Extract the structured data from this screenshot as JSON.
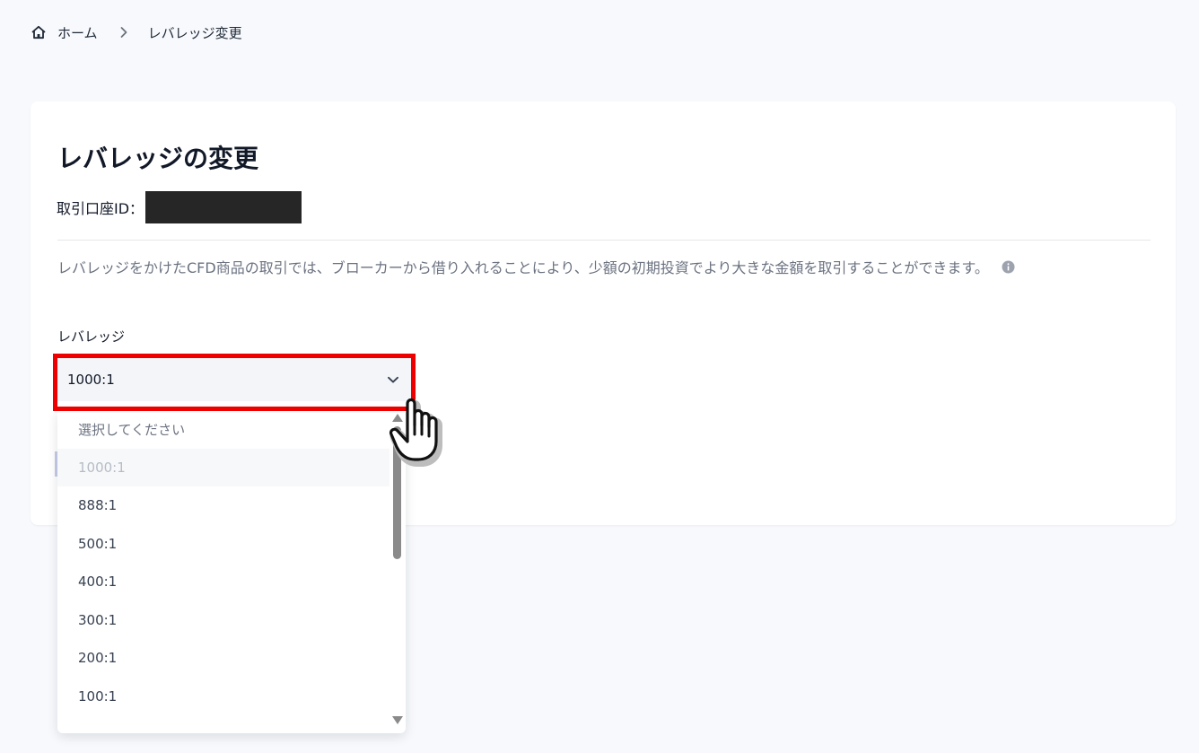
{
  "breadcrumb": {
    "home_label": "ホーム",
    "current_label": "レバレッジ変更"
  },
  "card": {
    "title": "レバレッジの変更",
    "account_label": "取引口座ID："
  },
  "description": {
    "text": "レバレッジをかけたCFD商品の取引では、ブローカーから借り入れることにより、少額の初期投資でより大きな金額を取引することができます。"
  },
  "leverage": {
    "label": "レバレッジ",
    "selected_value": "1000:1",
    "options": [
      "選択してください",
      "1000:1",
      "888:1",
      "500:1",
      "400:1",
      "300:1",
      "200:1",
      "100:1"
    ]
  },
  "icons": {
    "home": "home-icon",
    "separator": "chevron-right-icon",
    "info": "info-icon",
    "dropdown": "chevron-down-icon",
    "pointer": "hand-pointer-icon"
  },
  "colors": {
    "highlight": "#ee0000",
    "background": "#f7f9fc",
    "card": "#ffffff",
    "redacted": "#262626"
  }
}
